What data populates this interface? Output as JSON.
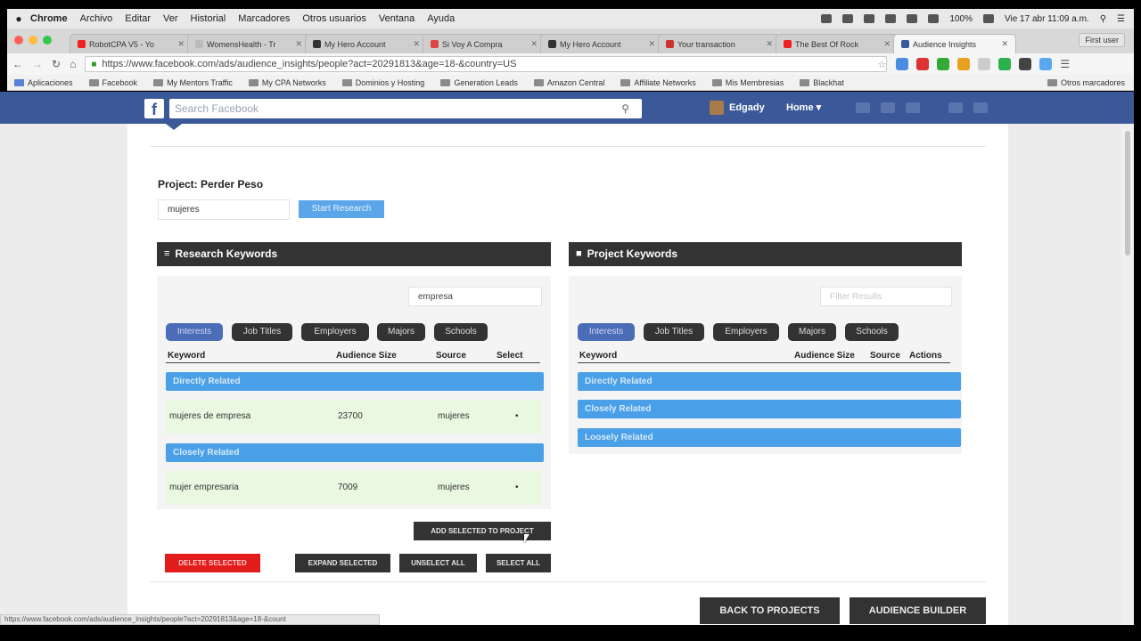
{
  "menubar": {
    "app": "Chrome",
    "items": [
      "Archivo",
      "Editar",
      "Ver",
      "Historial",
      "Marcadores",
      "Otros usuarios",
      "Ventana",
      "Ayuda"
    ],
    "battery": "100%",
    "clock": "Vie 17 abr  11:09 a.m."
  },
  "browser": {
    "tabs": [
      {
        "label": "RobotCPA V5 - Yo",
        "color": "#e22"
      },
      {
        "label": "WomensHealth - Tr",
        "color": "#bbb"
      },
      {
        "label": "My Hero Account",
        "color": "#333"
      },
      {
        "label": "Si Voy A Compra",
        "color": "#d44"
      },
      {
        "label": "My Hero Account",
        "color": "#333"
      },
      {
        "label": "Your transaction",
        "color": "#c33"
      },
      {
        "label": "The Best Of Rock",
        "color": "#e22"
      },
      {
        "label": "Audience Insights",
        "color": "#3b5998"
      }
    ],
    "user_button": "First user",
    "url": "https://www.facebook.com/ads/audience_insights/people?act=20291813&age=18-&country=US",
    "bookmarks": [
      "Aplicaciones",
      "Facebook",
      "My Mentors Traffic",
      "My CPA Networks",
      "Dominios y Hosting",
      "Generation Leads",
      "Amazon Central",
      "Affiliate Networks",
      "Mis Membresias",
      "Blackhat"
    ],
    "other_bookmarks": "Otros marcadores",
    "status_url": "https://www.facebook.com/ads/audience_insights/people?act=20291813&age=18-&count"
  },
  "facebook": {
    "logo": "f",
    "search_placeholder": "Search Facebook",
    "user": "Edgady",
    "home": "Home"
  },
  "project": {
    "title": "Project: Perder Peso",
    "input_value": "mujeres",
    "start_button": "Start Research"
  },
  "research": {
    "title": "Research Keywords",
    "filter_value": "empresa",
    "tabs": [
      "Interests",
      "Job Titles",
      "Employers",
      "Majors",
      "Schools"
    ],
    "columns": [
      "Keyword",
      "Audience Size",
      "Source",
      "Select"
    ],
    "group_direct": "Directly Related",
    "group_close": "Closely Related",
    "rows": [
      {
        "keyword": "mujeres de empresa",
        "size": "23700",
        "source": "mujeres",
        "select": "•"
      },
      {
        "keyword": "mujer empresaria",
        "size": "7009",
        "source": "mujeres",
        "select": "•"
      }
    ],
    "add_button": "ADD SELECTED TO PROJECT",
    "delete_button": "DELETE SELECTED",
    "expand_button": "EXPAND SELECTED",
    "unselect_button": "UNSELECT ALL",
    "select_button": "SELECT ALL"
  },
  "project_keywords": {
    "title": "Project Keywords",
    "filter_placeholder": "Filter Results",
    "tabs": [
      "Interests",
      "Job Titles",
      "Employers",
      "Majors",
      "Schools"
    ],
    "columns": [
      "Keyword",
      "Audience Size",
      "Source",
      "Actions"
    ],
    "group_direct": "Directly Related",
    "group_close": "Closely Related",
    "group_loose": "Loosely Related"
  },
  "footer": {
    "back_button": "BACK TO PROJECTS",
    "builder_button": "AUDIENCE BUILDER"
  }
}
